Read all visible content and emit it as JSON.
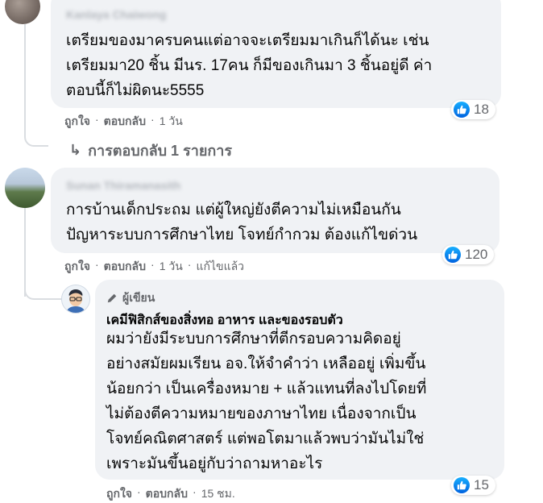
{
  "colors": {
    "bubble": "#f0f2f5",
    "meta": "#65676b",
    "like_blue": "#1877f2"
  },
  "comments": [
    {
      "author_blurred": "Kanlaya Chaiwong",
      "text": "เตรียมของมาครบคนแต่อาจจะเตรียมมาเกินก็ได้นะ เช่น\nเตรียมมา20 ชิ้น มีนร. 17คน ก็มีของเกินมา 3 ชิ้นอยู่ดี ค่า\nตอบนี้ก็ไม่ผิดนะ5555",
      "like_label": "ถูกใจ",
      "reply_label": "ตอบกลับ",
      "time": "1 วัน",
      "reactions": "18",
      "replies_label": "การตอบกลับ 1 รายการ"
    },
    {
      "author_blurred": "Sunan Thiramanasith",
      "text": "การบ้านเด็กประถม แต่ผู้ใหญ่ยังตีความไม่เหมือนกัน\nปัญหาระบบการศึกษาไทย โจทย์กำกวม ต้องแก้ไขด่วน",
      "like_label": "ถูกใจ",
      "reply_label": "ตอบกลับ",
      "time": "1 วัน",
      "edited": "แก้ไขแล้ว",
      "reactions": "120"
    }
  ],
  "reply": {
    "author_badge": "ผู้เขียน",
    "page_name": "เคมีฟิสิกส์ของสิ่งทอ อาหาร และของรอบตัว",
    "text": "ผมว่ายังมีระบบการศึกษาที่ตีกรอบความคิดอยู่\nอย่างสมัยผมเรียน อจ.ให้จำคำว่า เหลืออยู่ เพิ่มขึ้น\nน้อยกว่า เป็นเครื่องหมาย + แล้วแทนที่ลงไปโดยที่\nไม่ต้องตีความหมายของภาษาไทย เนื่องจากเป็น\nโจทย์คณิตศาสตร์ แต่พอโตมาแล้วพบว่ามันไม่ใช่\nเพราะมันขึ้นอยู่กับว่าถามหาอะไร",
    "like_label": "ถูกใจ",
    "reply_label": "ตอบกลับ",
    "time": "15 ชม.",
    "reactions": "15"
  },
  "icons": [
    "like-icon",
    "pencil-icon",
    "reply-arrow-icon",
    "avatar"
  ]
}
